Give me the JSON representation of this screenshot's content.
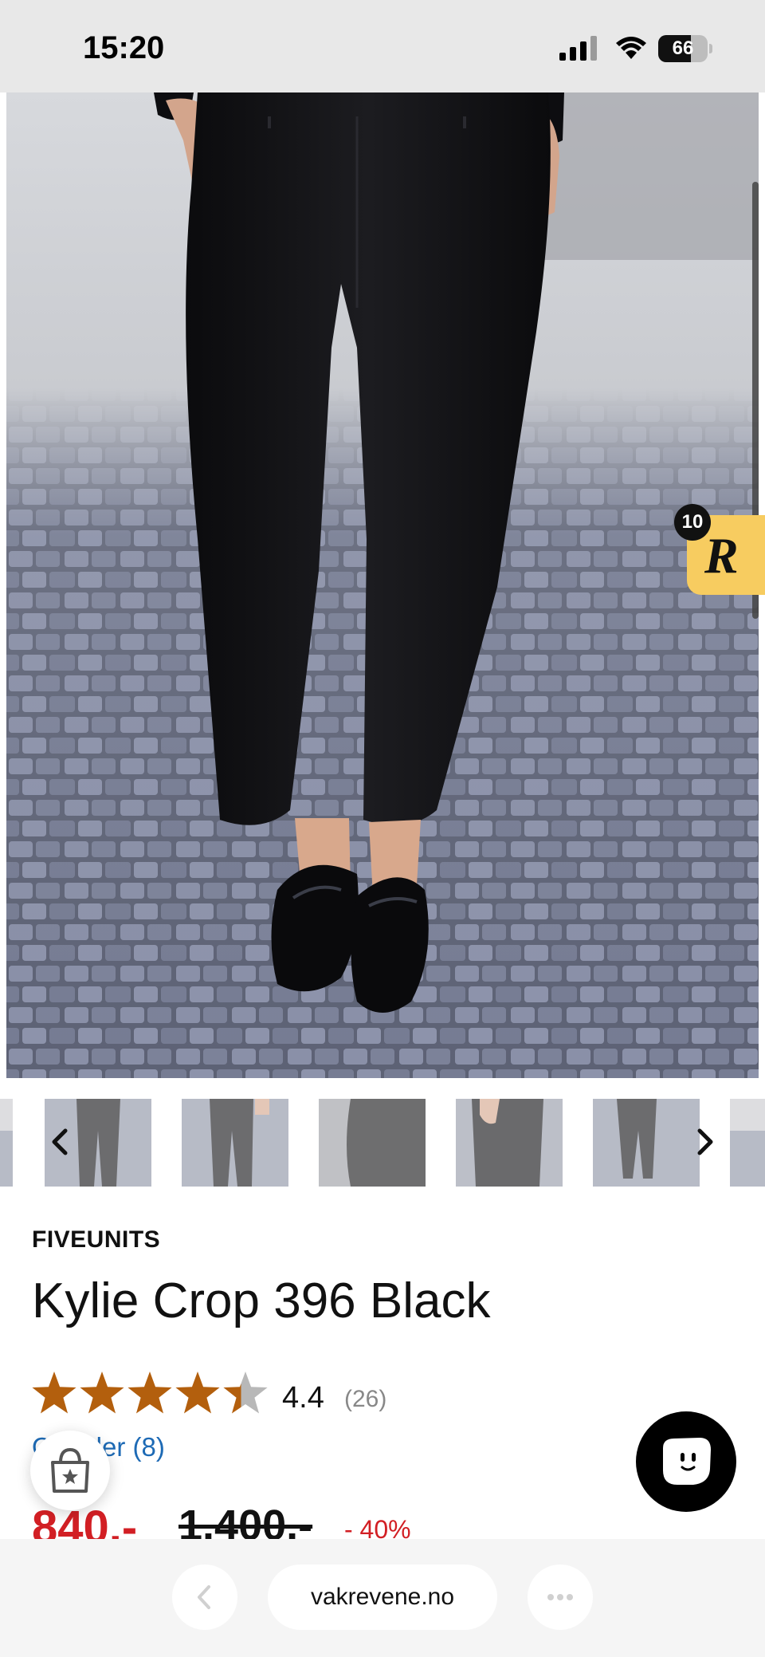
{
  "status_bar": {
    "time": "15:20",
    "battery": "66",
    "battery_level": 0.66
  },
  "rewards": {
    "badge": "10",
    "logo": "R",
    "accent": "#f7cc60"
  },
  "product": {
    "brand": "FIVEUNITS",
    "title": "Kylie Crop 396 Black",
    "rating": {
      "value": "4.4",
      "count": "(26)",
      "stars": 4.4,
      "star_color": "#b35f0d"
    },
    "reviews_link": "Omtaler (8)",
    "price": {
      "current": "840.-",
      "original": "1.400.-",
      "discount": "- 40%",
      "sale_color": "#d21f24"
    }
  },
  "thumbnails": {
    "count": 7,
    "prev_icon": "chevron-left-icon",
    "next_icon": "chevron-right-icon"
  },
  "browser": {
    "url": "vakrevene.no",
    "back_icon": "chevron-left-icon",
    "more_icon": "more-icon"
  },
  "link_color": "#1d6ab5"
}
